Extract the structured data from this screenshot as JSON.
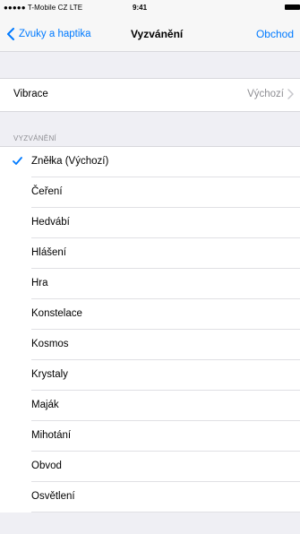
{
  "status_bar": {
    "carrier": "●●●●● T-Mobile CZ  LTE",
    "time": "9:41"
  },
  "nav": {
    "back_label": "Zvuky a haptika",
    "title": "Vyzvánění",
    "right_label": "Obchod"
  },
  "vibration": {
    "label": "Vibrace",
    "value": "Výchozí"
  },
  "ringtones": {
    "header": "VYZVÁNĚNÍ",
    "items": [
      {
        "label": "Zněłka (Výchozí)",
        "selected": true
      },
      {
        "label": "Čeření",
        "selected": false
      },
      {
        "label": "Hedvábí",
        "selected": false
      },
      {
        "label": "Hlášení",
        "selected": false
      },
      {
        "label": "Hra",
        "selected": false
      },
      {
        "label": "Konstelace",
        "selected": false
      },
      {
        "label": "Kosmos",
        "selected": false
      },
      {
        "label": "Krystaly",
        "selected": false
      },
      {
        "label": "Maják",
        "selected": false
      },
      {
        "label": "Mihotání",
        "selected": false
      },
      {
        "label": "Obvod",
        "selected": false
      },
      {
        "label": "Osvětlení",
        "selected": false
      }
    ]
  },
  "colors": {
    "accent": "#007aff",
    "brand_tab": "#e6007e"
  }
}
